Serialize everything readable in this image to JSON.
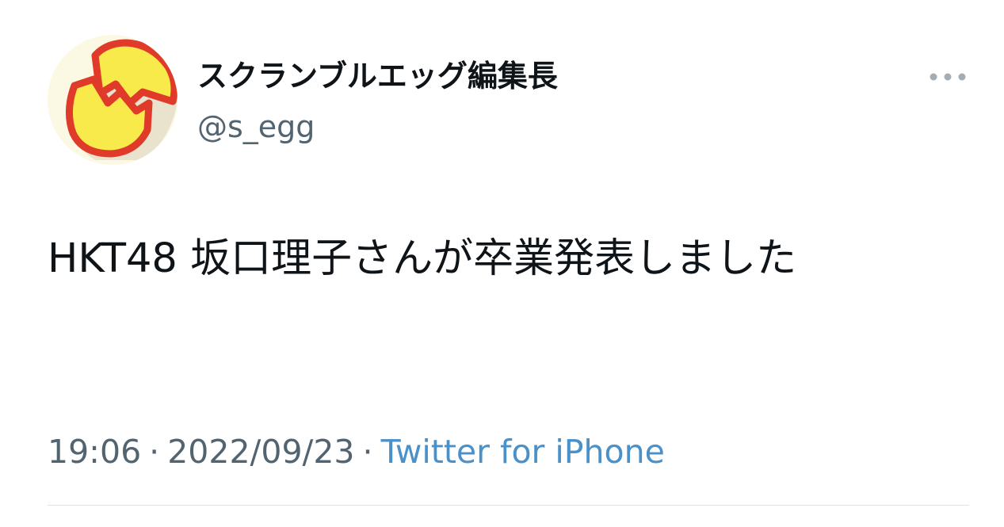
{
  "user": {
    "display_name": "スクランブルエッグ編集長",
    "handle": "@s_egg",
    "avatar_icon": "cracked-egg-logo"
  },
  "tweet": {
    "text": "HKT48 坂口理子さんが卒業発表しました",
    "time": "19:06",
    "date": "2022/09/23",
    "separator": "·",
    "source": "Twitter for iPhone"
  },
  "actions": {
    "more_icon": "more-horizontal-icon"
  },
  "colors": {
    "text_primary": "#0f1419",
    "text_secondary": "#536471",
    "link": "#4a90c9",
    "egg_yellow": "#f7ea4a",
    "egg_red": "#e03a2a",
    "avatar_bg": "#fbf8e3"
  }
}
